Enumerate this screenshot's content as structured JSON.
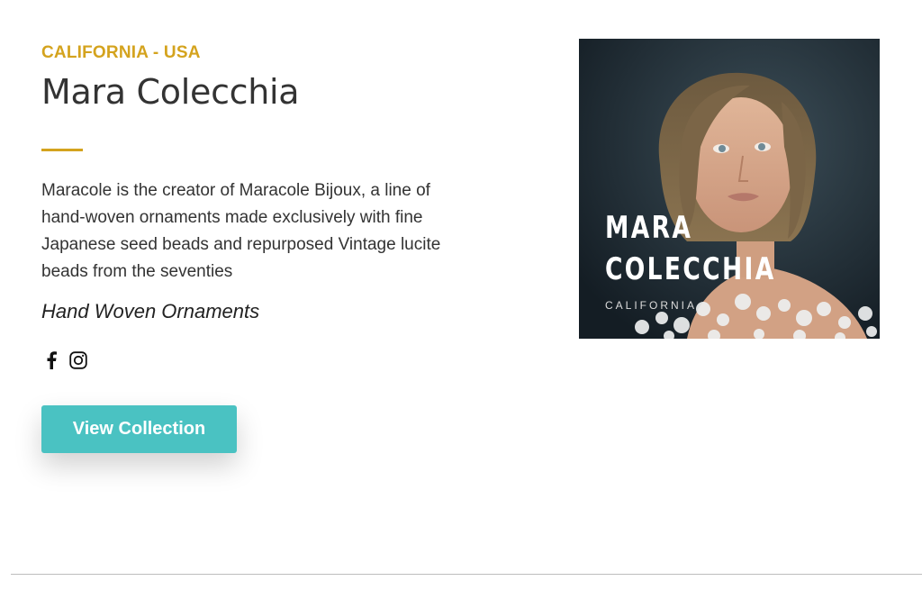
{
  "artist": {
    "location": "CALIFORNIA - USA",
    "name": "Mara Colecchia",
    "bio": "Maracole is the creator of Maracole Bijoux, a line of hand-woven ornaments made exclusively with fine Japanese seed beads and repurposed Vintage lucite beads from the seventies",
    "tagline": "Hand Woven Ornaments"
  },
  "social": {
    "facebook_icon": "facebook-icon",
    "instagram_icon": "instagram-icon"
  },
  "cta": {
    "label": "View Collection",
    "color": "#4ac2c2"
  },
  "portrait": {
    "name_line_1": "MARA",
    "name_line_2": "COLECCHIA",
    "location": "CALIFORNIA"
  },
  "colors": {
    "accent": "#d4a31e",
    "text": "#333333"
  }
}
